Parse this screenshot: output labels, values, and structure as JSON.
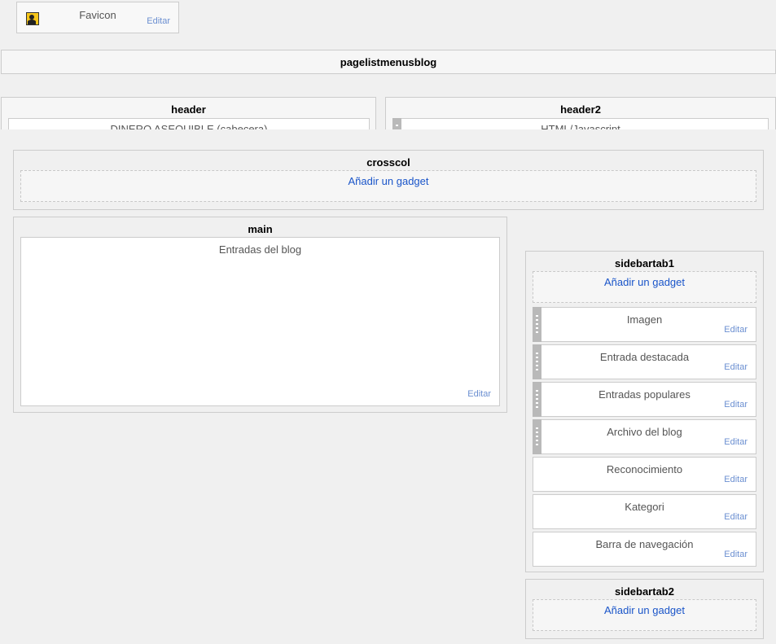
{
  "favicon": {
    "title": "Favicon",
    "edit": "Editar"
  },
  "pagelist": {
    "title": "pagelistmenusblog"
  },
  "header": {
    "title": "header",
    "widget_title": "DINERO ASEQUIBLE (cabecera)"
  },
  "header2": {
    "title": "header2",
    "widget_title": "HTML/Javascript"
  },
  "crosscol": {
    "title": "crosscol",
    "add": "Añadir un gadget"
  },
  "main": {
    "title": "main",
    "widget_title": "Entradas del blog",
    "edit": "Editar"
  },
  "sidebartab1": {
    "title": "sidebartab1",
    "add": "Añadir un gadget",
    "widgets": [
      {
        "title": "Imagen",
        "edit": "Editar",
        "draggable": true
      },
      {
        "title": "Entrada destacada",
        "edit": "Editar",
        "draggable": true
      },
      {
        "title": "Entradas populares",
        "edit": "Editar",
        "draggable": true
      },
      {
        "title": "Archivo del blog",
        "edit": "Editar",
        "draggable": true
      },
      {
        "title": "Reconocimiento",
        "edit": "Editar",
        "draggable": false
      },
      {
        "title": "Kategori",
        "edit": "Editar",
        "draggable": false
      },
      {
        "title": "Barra de navegación",
        "edit": "Editar",
        "draggable": false
      }
    ]
  },
  "sidebartab2": {
    "title": "sidebartab2",
    "add": "Añadir un gadget"
  },
  "colors": {
    "link": "#1a55c9",
    "edit": "#6b8fd1",
    "grip": "#b9b9b9",
    "favicon_bg": "#f5c518"
  }
}
